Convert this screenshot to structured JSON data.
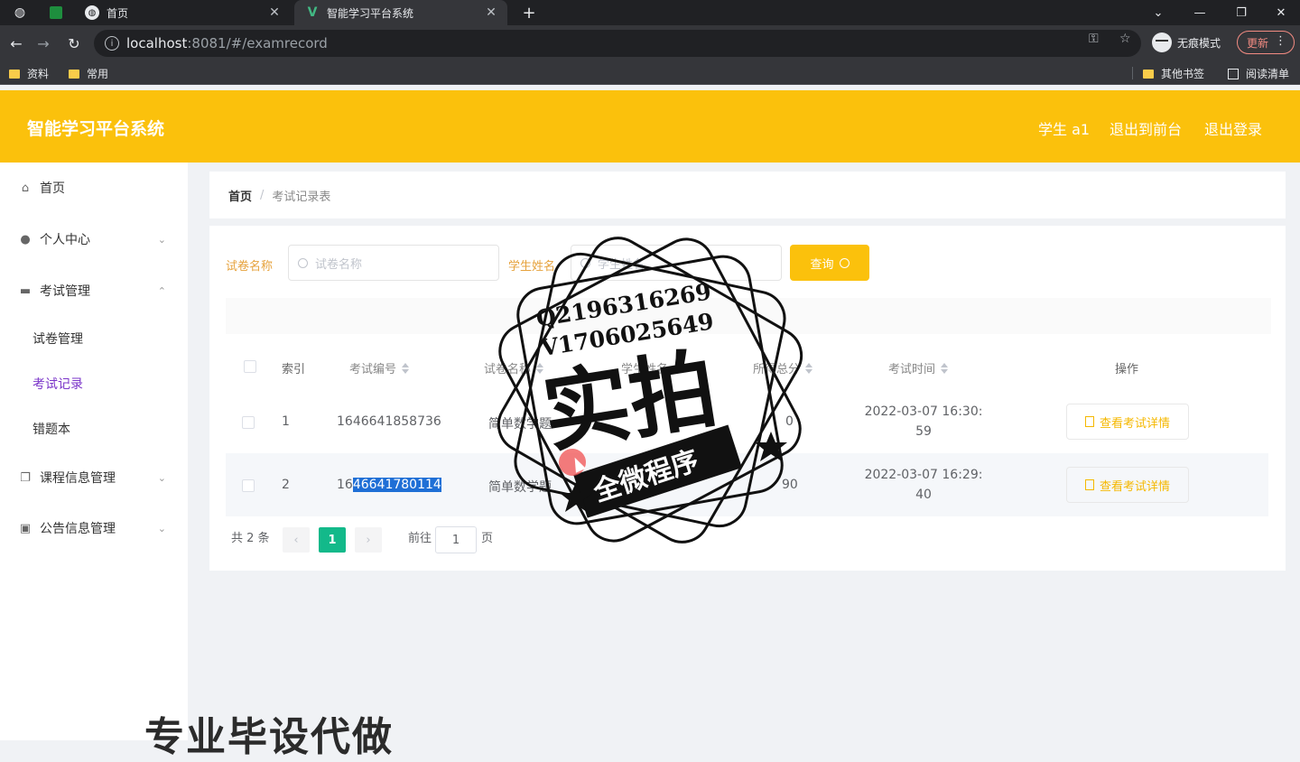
{
  "browser": {
    "tabs": [
      {
        "title": "首页",
        "active": false
      },
      {
        "title": "智能学习平台系统",
        "active": true
      }
    ],
    "new_tab_icon": "plus-icon",
    "url": {
      "host": "localhost",
      "path": ":8081/#/examrecord"
    },
    "profile_label": "无痕模式",
    "update_label": "更新",
    "bookmarks": [
      "资料",
      "常用"
    ],
    "bookmarks_right": [
      "其他书签",
      "阅读清单"
    ]
  },
  "header": {
    "brand": "智能学习平台系统",
    "user": "学生 a1",
    "exit_front": "退出到前台",
    "logout": "退出登录",
    "accent_color": "#fbc10c"
  },
  "sidebar": {
    "items": [
      {
        "label": "首页",
        "icon": "home-icon"
      },
      {
        "label": "个人中心",
        "icon": "user-icon"
      },
      {
        "label": "考试管理",
        "icon": "chat-icon"
      },
      {
        "label": "试卷管理"
      },
      {
        "label": "考试记录",
        "active": true
      },
      {
        "label": "错题本"
      },
      {
        "label": "课程信息管理",
        "icon": "copy-icon"
      },
      {
        "label": "公告信息管理",
        "icon": "trash-icon"
      }
    ]
  },
  "breadcrumb": {
    "home": "首页",
    "sep": "/",
    "current": "考试记录表"
  },
  "search": {
    "paper_label": "试卷名称",
    "paper_placeholder": "试卷名称",
    "student_label": "学生姓名",
    "student_placeholder": "学生姓名",
    "query_label": "查询"
  },
  "table": {
    "columns": [
      "索引",
      "考试编号",
      "试卷名称",
      "学生姓名",
      "所得总分",
      "考试时间",
      "操作"
    ],
    "rows": [
      {
        "index": "1",
        "id_prefix": "1646641858736",
        "id_selected": "",
        "paper": "简单数学题",
        "score": "0",
        "time_line1": "2022-03-07 16:30:",
        "time_line2": "59",
        "action": "查看考试详情"
      },
      {
        "index": "2",
        "id_prefix": "16",
        "id_selected": "46641780114",
        "paper": "简单数学题",
        "score": "90",
        "time_line1": "2022-03-07 16:29:",
        "time_line2": "40",
        "action": "查看考试详情"
      }
    ]
  },
  "pagination": {
    "total": "共 2 条",
    "current_page": "1",
    "goto_label": "前往",
    "goto_value": "1",
    "page_suffix": "页"
  },
  "watermark": {
    "line1": "Q2196316269",
    "line2": "V1706025649",
    "big": "实拍",
    "banner": "全微程序"
  },
  "caption": "专业毕设代做"
}
